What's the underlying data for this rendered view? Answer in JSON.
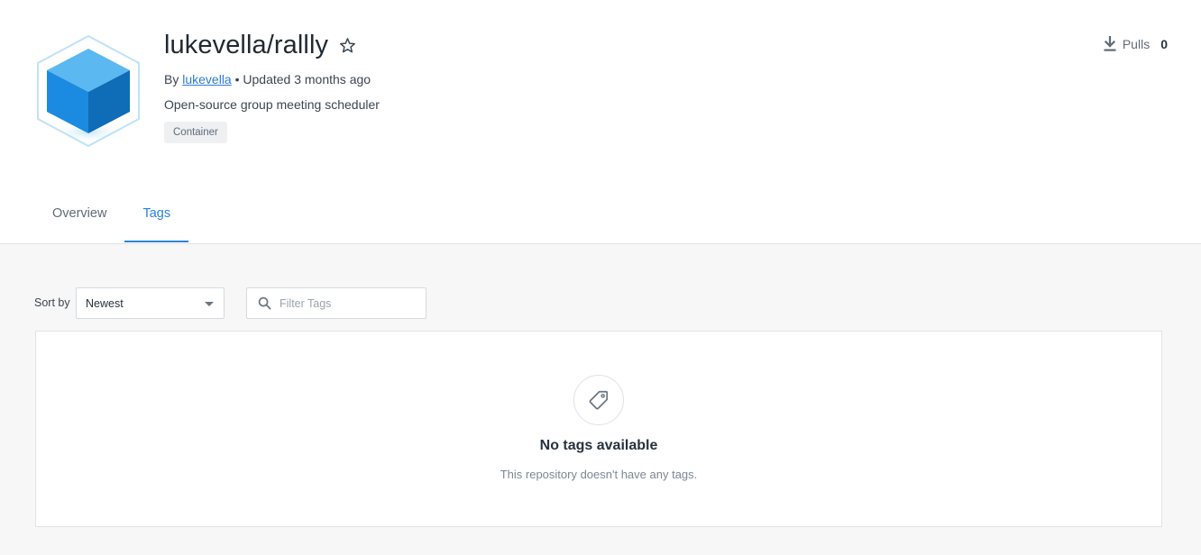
{
  "repo": {
    "name": "lukevella/rallly",
    "by_prefix": "By",
    "owner": "lukevella",
    "updated": "• Updated 3 months ago",
    "description": "Open-source group meeting scheduler",
    "badge": "Container"
  },
  "stats": {
    "pulls_label": "Pulls",
    "pulls_count": "0"
  },
  "tabs": [
    {
      "label": "Overview",
      "active": false
    },
    {
      "label": "Tags",
      "active": true
    }
  ],
  "toolbar": {
    "sort_label": "Sort by",
    "sort_value": "Newest",
    "filter_placeholder": "Filter Tags"
  },
  "empty_state": {
    "title": "No tags available",
    "message": "This repository doesn't have any tags."
  },
  "colors": {
    "accent": "#2b83d9",
    "link": "#2b7bd6",
    "cube_light": "#5bb8f0",
    "cube_mid": "#1a8be0",
    "cube_dark": "#0f6cb6"
  },
  "icons": [
    "cube-logo-icon",
    "star-icon",
    "download-icon",
    "search-icon",
    "tag-icon",
    "caret-down-icon"
  ]
}
